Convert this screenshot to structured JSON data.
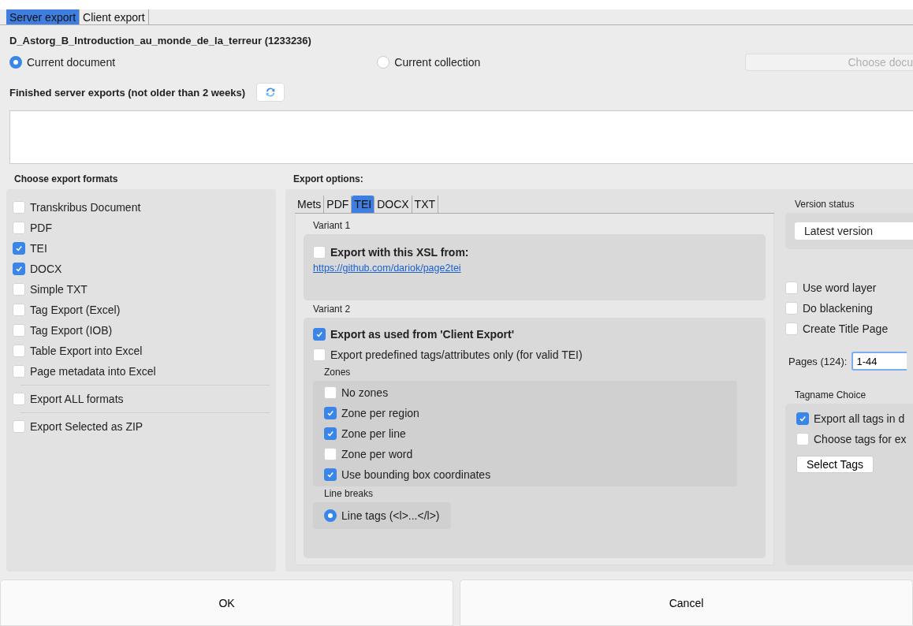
{
  "tabs": [
    {
      "label": "Server export",
      "selected": true
    },
    {
      "label": "Client export",
      "selected": false
    }
  ],
  "document_title": "D_Astorg_B_Introduction_au_monde_de_la_terreur (1233236)",
  "scope": [
    {
      "label": "Current document",
      "selected": true
    },
    {
      "label": "Current collection",
      "selected": false
    }
  ],
  "choose_document_button": {
    "label": "Choose docu",
    "disabled": true
  },
  "finished_exports": {
    "label": "Finished server exports (not older than 2 weeks)"
  },
  "formats": {
    "title": "Choose export formats",
    "groups": [
      {
        "items": [
          {
            "label": "Transkribus Document",
            "checked": false
          },
          {
            "label": "PDF",
            "checked": false
          },
          {
            "label": "TEI",
            "checked": true
          },
          {
            "label": "DOCX",
            "checked": true
          },
          {
            "label": "Simple TXT",
            "checked": false
          },
          {
            "label": "Tag Export (Excel)",
            "checked": false
          },
          {
            "label": "Tag Export (IOB)",
            "checked": false
          },
          {
            "label": "Table Export into Excel",
            "checked": false
          },
          {
            "label": "Page metadata into Excel",
            "checked": false
          }
        ]
      },
      {
        "items": [
          {
            "label": "Export ALL formats",
            "checked": false
          }
        ]
      },
      {
        "items": [
          {
            "label": "Export Selected as ZIP",
            "checked": false
          }
        ]
      }
    ]
  },
  "export_options": {
    "title": "Export options:",
    "tabs": [
      {
        "label": "Mets",
        "selected": false
      },
      {
        "label": "PDF",
        "selected": false
      },
      {
        "label": "TEI",
        "selected": true
      },
      {
        "label": "DOCX",
        "selected": false
      },
      {
        "label": "TXT",
        "selected": false
      }
    ],
    "variant1": {
      "title": "Variant 1",
      "option": {
        "label": "Export with this XSL from:",
        "checked": false
      },
      "link": "https://github.com/dariok/page2tei"
    },
    "variant2": {
      "title": "Variant 2",
      "options": [
        {
          "label": "Export as used from 'Client Export'",
          "checked": true,
          "bold": true
        },
        {
          "label": "Export predefined tags/attributes only (for valid TEI)",
          "checked": false,
          "bold": false
        }
      ],
      "zones": {
        "title": "Zones",
        "items": [
          {
            "label": "No zones",
            "checked": false
          },
          {
            "label": "Zone per region",
            "checked": true
          },
          {
            "label": "Zone per line",
            "checked": true
          },
          {
            "label": "Zone per word",
            "checked": false
          },
          {
            "label": "Use bounding box coordinates",
            "checked": true
          }
        ]
      },
      "line_breaks": {
        "title": "Line breaks",
        "options": [
          {
            "label": "Line tags (<l>...</l>)",
            "selected": true
          }
        ]
      }
    }
  },
  "version_status": {
    "title": "Version status",
    "value": "Latest version"
  },
  "layer_options": [
    {
      "label": "Use word layer",
      "checked": false
    },
    {
      "label": "Do blackening",
      "checked": false
    },
    {
      "label": "Create Title Page",
      "checked": false
    }
  ],
  "pages": {
    "label": "Pages (124):",
    "value": "1-44"
  },
  "tagname_choice": {
    "title": "Tagname Choice",
    "options": [
      {
        "label": "Export all tags in d",
        "checked": true
      },
      {
        "label": "Choose tags for ex",
        "checked": false
      }
    ],
    "button": "Select Tags"
  },
  "buttons": [
    {
      "label": "OK"
    },
    {
      "label": "Cancel"
    }
  ]
}
